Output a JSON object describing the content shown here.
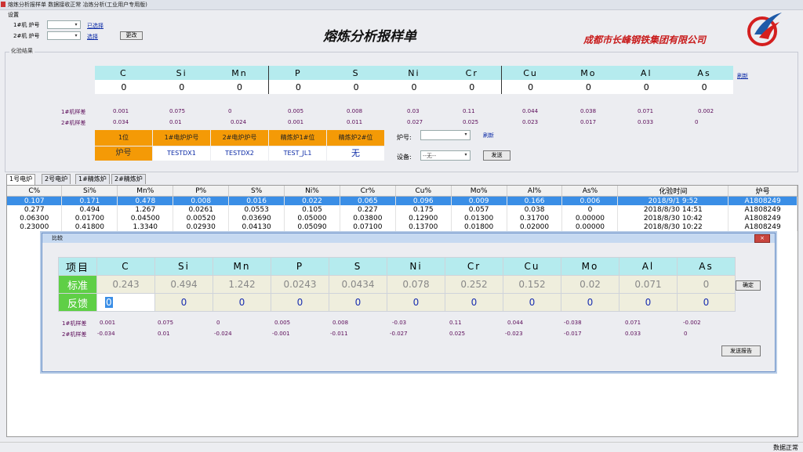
{
  "window": {
    "title": "熔炼分析报样单   数据接收正常  冶炼分析(工业用户专用版)"
  },
  "settings": {
    "group_label": "设置",
    "furnace1_label": "1#机 炉号",
    "furnace2_label": "2#机 炉号",
    "set1_link": "已选择",
    "set2_link": "选择",
    "apply_button": "更改"
  },
  "app_title": "熔炼分析报样单",
  "company": "成都市长峰钢铁集团有限公司",
  "results_group": "化验结果",
  "elements": [
    "C",
    "Si",
    "Mn",
    "P",
    "S",
    "Ni",
    "Cr",
    "Cu",
    "Mo",
    "Al",
    "As"
  ],
  "values": [
    "0",
    "0",
    "0",
    "0",
    "0",
    "0",
    "0",
    "0",
    "0",
    "0",
    "0"
  ],
  "refresh_link": "刷新",
  "sample1": {
    "label": "1#机样差",
    "values": [
      "0.001",
      "0.075",
      "0",
      "0.005",
      "0.008",
      "0.03",
      "0.11",
      "0.044",
      "0.038",
      "0.071",
      "0.002"
    ]
  },
  "sample2": {
    "label": "2#机样差",
    "values": [
      "0.034",
      "0.01",
      "0.024",
      "0.001",
      "0.011",
      "0.027",
      "0.025",
      "0.023",
      "0.017",
      "0.033",
      "0"
    ]
  },
  "station": {
    "headers": [
      "1位",
      "1#电炉炉号",
      "2#电炉炉号",
      "精炼炉1#位",
      "精炼炉2#位"
    ],
    "row_label": "炉号",
    "row_values": [
      "TESTDX1",
      "TESTDX2",
      "TEST_JL1",
      "无"
    ]
  },
  "furnace_select": {
    "label": "炉号:",
    "value": "",
    "link": "刷新"
  },
  "device_select": {
    "label": "设备:",
    "value": "--无--"
  },
  "send_button": "发送",
  "tabs": [
    "1号电炉",
    "2号电炉",
    "1#精炼炉",
    "2#精炼炉"
  ],
  "grid": {
    "columns": [
      "C%",
      "Si%",
      "Mn%",
      "P%",
      "S%",
      "Ni%",
      "Cr%",
      "Cu%",
      "Mo%",
      "Al%",
      "As%",
      "化验时间",
      "炉号"
    ],
    "rows": [
      [
        "0.107",
        "0.171",
        "0.478",
        "0.008",
        "0.016",
        "0.022",
        "0.065",
        "0.096",
        "0.009",
        "0.166",
        "0.006",
        "2018/9/1 9:52",
        "A1808249"
      ],
      [
        "0.277",
        "0.494",
        "1.267",
        "0.0261",
        "0.0553",
        "0.105",
        "0.227",
        "0.175",
        "0.057",
        "0.038",
        "0",
        "2018/8/30 14:51",
        "A1808249"
      ],
      [
        "0.06300",
        "0.01700",
        "0.04500",
        "0.00520",
        "0.03690",
        "0.05000",
        "0.03800",
        "0.12900",
        "0.01300",
        "0.31700",
        "0.00000",
        "2018/8/30 10:42",
        "A1808249"
      ],
      [
        "0.23000",
        "0.41800",
        "1.3340",
        "0.02930",
        "0.04130",
        "0.05090",
        "0.07100",
        "0.13700",
        "0.01800",
        "0.02000",
        "0.00000",
        "2018/8/30 10:22",
        "A1808249"
      ]
    ]
  },
  "dialog": {
    "title": "比较",
    "close": "×",
    "header_label": "项目",
    "standard_label": "标准",
    "feedback_label": "反馈",
    "standard_values": [
      "0.243",
      "0.494",
      "1.242",
      "0.0243",
      "0.0434",
      "0.078",
      "0.252",
      "0.152",
      "0.02",
      "0.071",
      "0"
    ],
    "feedback_values": [
      "0",
      "0",
      "0",
      "0",
      "0",
      "0",
      "0",
      "0",
      "0",
      "0",
      "0"
    ],
    "confirm_button": "确定",
    "sample1_label": "1#机样差",
    "sample1_values": [
      "0.001",
      "0.075",
      "0",
      "0.005",
      "0.008",
      "-0.03",
      "0.11",
      "0.044",
      "-0.038",
      "0.071",
      "-0.002"
    ],
    "sample2_label": "2#机样差",
    "sample2_values": [
      "-0.034",
      "0.01",
      "-0.024",
      "-0.001",
      "-0.011",
      "-0.027",
      "0.025",
      "-0.023",
      "-0.017",
      "0.033",
      "0"
    ],
    "send_report_button": "发送报告"
  },
  "status": {
    "text": "数据正常"
  }
}
